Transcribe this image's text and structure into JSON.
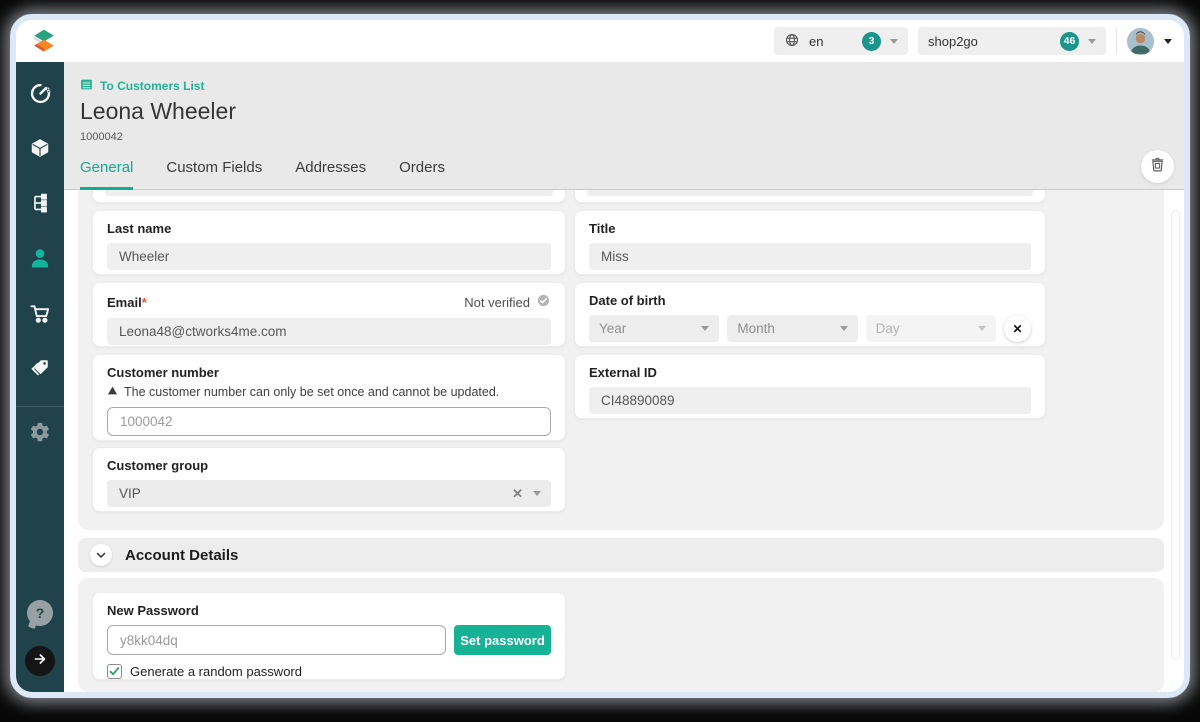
{
  "topbar": {
    "language": {
      "value": "en",
      "badge": "3"
    },
    "project": {
      "value": "shop2go",
      "badge": "46"
    }
  },
  "sidebar": {
    "items": [
      "dashboard",
      "products",
      "categories",
      "customers",
      "orders",
      "discounts",
      "settings"
    ],
    "active": "customers",
    "help_label": "?"
  },
  "header": {
    "breadcrumb": "To Customers List",
    "title": "Leona Wheeler",
    "customer_id": "1000042",
    "tabs": [
      "General",
      "Custom Fields",
      "Addresses",
      "Orders"
    ]
  },
  "form": {
    "last_name": {
      "label": "Last name",
      "value": "Wheeler"
    },
    "title": {
      "label": "Title",
      "value": "Miss"
    },
    "email": {
      "label": "Email",
      "required_mark": "*",
      "status": "Not verified",
      "value": "Leona48@ctworks4me.com"
    },
    "date_of_birth": {
      "label": "Date of birth",
      "year_placeholder": "Year",
      "month_placeholder": "Month",
      "day_placeholder": "Day",
      "clear": "✕"
    },
    "customer_number": {
      "label": "Customer number",
      "warning": "The customer number can only be set once and cannot be updated.",
      "value": "1000042"
    },
    "external_id": {
      "label": "External ID",
      "value": "CI48890089"
    },
    "customer_group": {
      "label": "Customer group",
      "value": "VIP",
      "clear": "✕"
    }
  },
  "account": {
    "section_title": "Account Details",
    "new_password": {
      "label": "New Password",
      "value": "y8kk04dq",
      "button": "Set password",
      "checkbox_label": "Generate a random password",
      "checked": true
    }
  },
  "colors": {
    "accent": "#14ab90",
    "badge": "#1b948b",
    "sidebar_bg": "#20424a",
    "header_bg": "#e9e9e9"
  }
}
